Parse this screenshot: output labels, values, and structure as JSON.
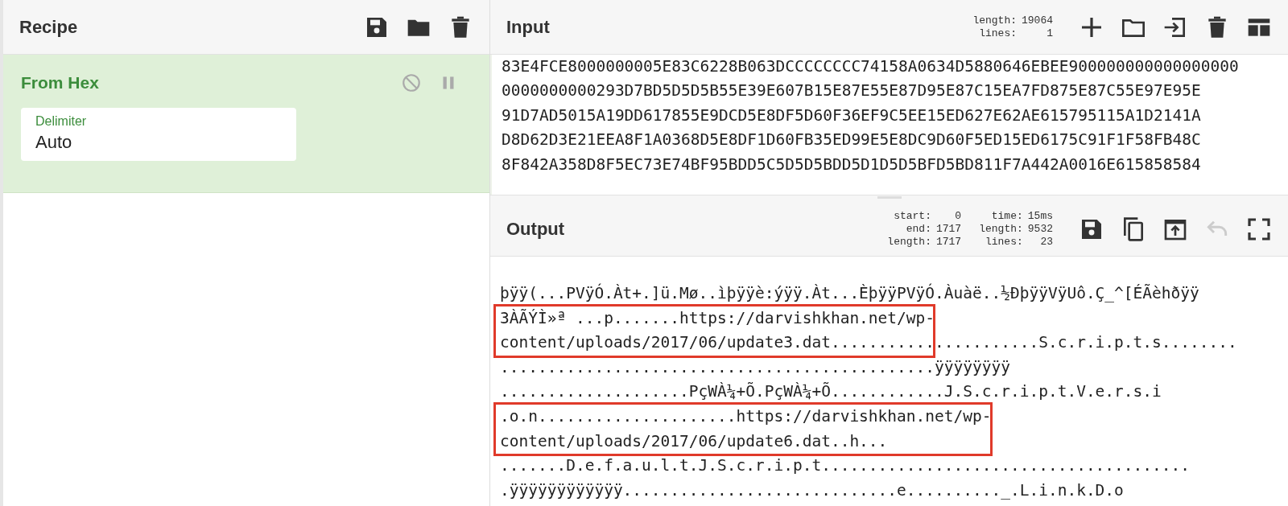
{
  "recipe": {
    "title": "Recipe",
    "operations": [
      {
        "name": "From Hex",
        "disabled": false,
        "breakpoint": false,
        "args": [
          {
            "label": "Delimiter",
            "value": "Auto"
          }
        ]
      }
    ]
  },
  "input": {
    "title": "Input",
    "stats": [
      {
        "label": "length:",
        "value": "19064"
      },
      {
        "label": "lines:",
        "value": "1"
      }
    ],
    "lines": [
      "83E4FCE8000000005E83C6228B063DCCCCCCCC74158A0634D5880646EBEE900000000000000000",
      "0000000000293D7BD5D5D5B55E39E607B15E87E55E87D95E87C15EA7FD875E87C55E97E95E",
      "91D7AD5015A19DD617855E9DCD5E8DF5D60F36EF9C5EE15ED627E62AE615795115A1D2141A",
      "D8D62D3E21EEA8F1A0368D5E8DF1D60FB35ED99E5E8DC9D60F5ED15ED6175C91F1F58FB48C",
      "8F842A358D8F5EC73E74BF95BDD5C5D5D5BDD5D1D5D5BFD5BD811F7A442A0016E615858584"
    ]
  },
  "output": {
    "title": "Output",
    "stats": [
      {
        "label": "start:",
        "value": "0"
      },
      {
        "label": "time:",
        "value": "15ms"
      },
      {
        "label": "end:",
        "value": "1717"
      },
      {
        "label": "length:",
        "value": "9532"
      },
      {
        "label": "length:",
        "value": "1717"
      },
      {
        "label": "lines:",
        "value": "23"
      }
    ],
    "undo_disabled": true,
    "blocks": [
      {
        "highlighted": false,
        "lines": [
          "þÿÿ(...PVÿÓ.Àt+.]ü.Mø..ìþÿÿè:ýÿÿ.Àt...ÈþÿÿPVÿÓ.Àuàë..½ÐþÿÿVÿUô.Ç_^[ÉÃèhðÿÿ"
        ]
      },
      {
        "highlighted": true,
        "lines": [
          "3ÀÃÝÌ»ª ...p.......https://darvishkhan.net/wp-",
          "content/uploads/2017/06/update3.dat......................S.c.r.i.p.t.s........"
        ]
      },
      {
        "highlighted": false,
        "lines": [
          "..............................................ÿÿÿÿÿÿÿÿ",
          "....................PçWÀ¼+Õ.PçWÀ¼+Õ............J.S.c.r.i.p.t.V.e.r.s.i"
        ]
      },
      {
        "highlighted": true,
        "lines": [
          ".o.n.....................https://darvishkhan.net/wp-",
          "content/uploads/2017/06/update6.dat..h..."
        ]
      },
      {
        "highlighted": false,
        "lines": [
          ".......D.e.f.a.u.l.t.J.S.c.r.i.p.t.......................................",
          ".ÿÿÿÿÿÿÿÿÿÿÿÿ.............................e.........._.L.i.n.k.D.o"
        ]
      }
    ]
  }
}
